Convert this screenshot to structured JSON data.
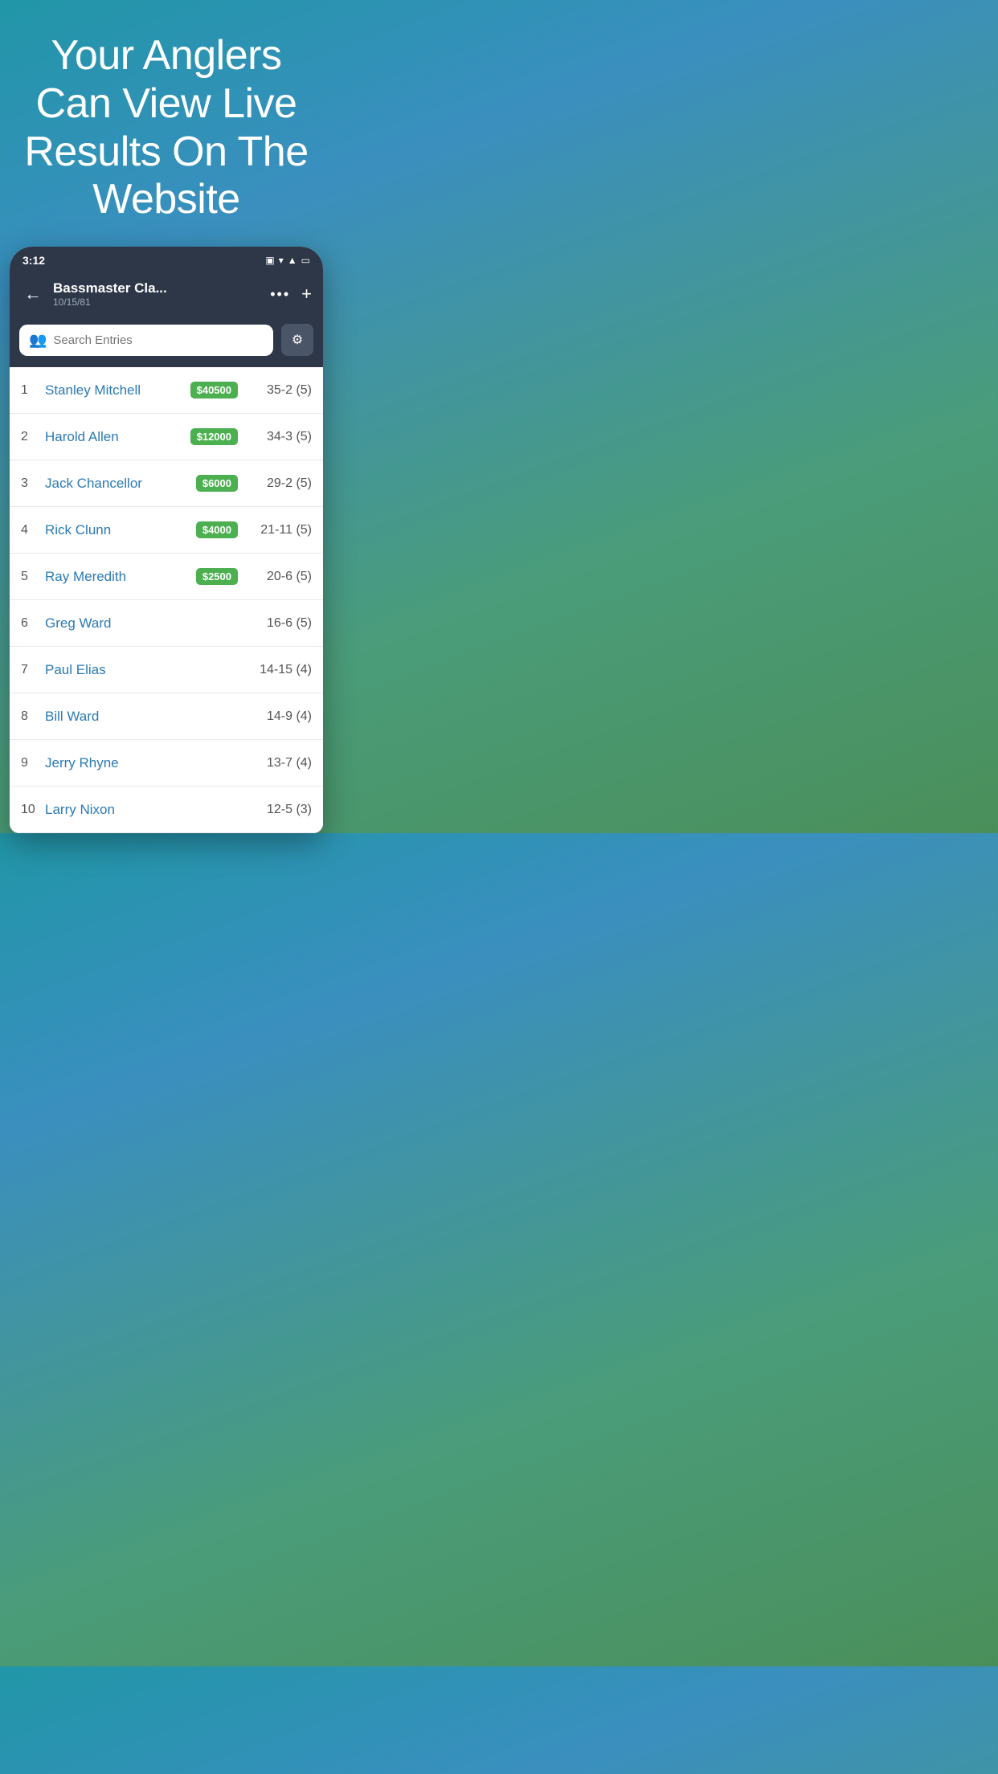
{
  "hero": {
    "title": "Your Anglers Can View Live Results On The Website"
  },
  "status_bar": {
    "time": "3:12",
    "icons": [
      "vibrate",
      "wifi",
      "signal",
      "battery"
    ]
  },
  "header": {
    "back_label": "←",
    "tournament_name": "Bassmaster Cla...",
    "tournament_date": "10/15/81",
    "more_label": "•••",
    "add_label": "+"
  },
  "search": {
    "placeholder": "Search Entries"
  },
  "entries": [
    {
      "rank": "1",
      "name": "Stanley Mitchell",
      "prize": "$40500",
      "score": "35-2 (5)"
    },
    {
      "rank": "2",
      "name": "Harold Allen",
      "prize": "$12000",
      "score": "34-3 (5)"
    },
    {
      "rank": "3",
      "name": "Jack Chancellor",
      "prize": "$6000",
      "score": "29-2 (5)"
    },
    {
      "rank": "4",
      "name": "Rick Clunn",
      "prize": "$4000",
      "score": "21-11 (5)"
    },
    {
      "rank": "5",
      "name": "Ray Meredith",
      "prize": "$2500",
      "score": "20-6 (5)"
    },
    {
      "rank": "6",
      "name": "Greg Ward",
      "prize": null,
      "score": "16-6 (5)"
    },
    {
      "rank": "7",
      "name": "Paul Elias",
      "prize": null,
      "score": "14-15 (4)"
    },
    {
      "rank": "8",
      "name": "Bill Ward",
      "prize": null,
      "score": "14-9 (4)"
    },
    {
      "rank": "9",
      "name": "Jerry Rhyne",
      "prize": null,
      "score": "13-7 (4)"
    },
    {
      "rank": "10",
      "name": "Larry Nixon",
      "prize": null,
      "score": "12-5 (3)"
    }
  ]
}
